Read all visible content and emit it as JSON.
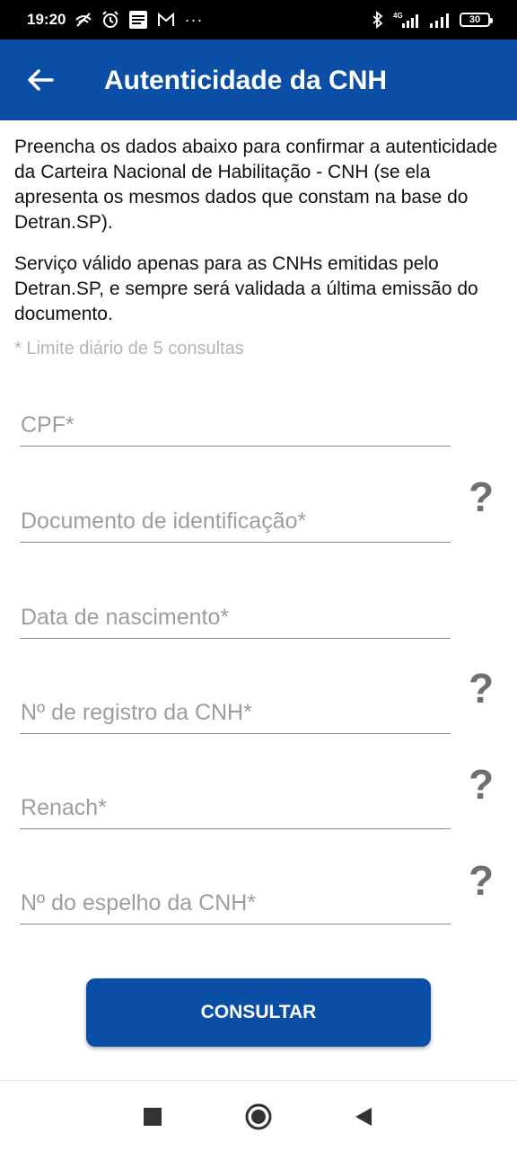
{
  "status_bar": {
    "time": "19:20",
    "battery": "30",
    "more": "···",
    "left_icons": [
      "wifi-off-icon",
      "alarm-icon",
      "sim-card-icon",
      "gmail-icon"
    ],
    "right_icons": [
      "bluetooth-icon",
      "signal-4g-icon",
      "signal-icon",
      "battery-icon"
    ]
  },
  "app_bar": {
    "title": "Autenticidade da CNH",
    "background": "#0A4EA6"
  },
  "intro": {
    "paragraph1": "Preencha os dados abaixo para confirmar a autenticidade da Carteira Nacional de Habilitação - CNH (se ela apresenta os mesmos dados que constam na base do Detran.SP).",
    "paragraph2": "Serviço válido apenas para as CNHs emitidas pelo Detran.SP, e sempre será validada a última emissão do documento."
  },
  "limit_note": "* Limite diário de 5 consultas",
  "form": {
    "fields": [
      {
        "placeholder": "CPF*",
        "value": "",
        "help": false
      },
      {
        "placeholder": "Documento de identificação*",
        "value": "",
        "help": true
      },
      {
        "placeholder": "Data de nascimento*",
        "value": "",
        "help": false
      },
      {
        "placeholder": "Nº de registro da CNH*",
        "value": "",
        "help": true
      },
      {
        "placeholder": "Renach*",
        "value": "",
        "help": true
      },
      {
        "placeholder": "Nº do espelho da CNH*",
        "value": "",
        "help": true
      }
    ],
    "help_symbol": "?",
    "submit_label": "CONSULTAR"
  },
  "nav_bar": {
    "buttons": [
      "recent-apps-icon",
      "home-icon",
      "back-triangle-icon"
    ]
  }
}
